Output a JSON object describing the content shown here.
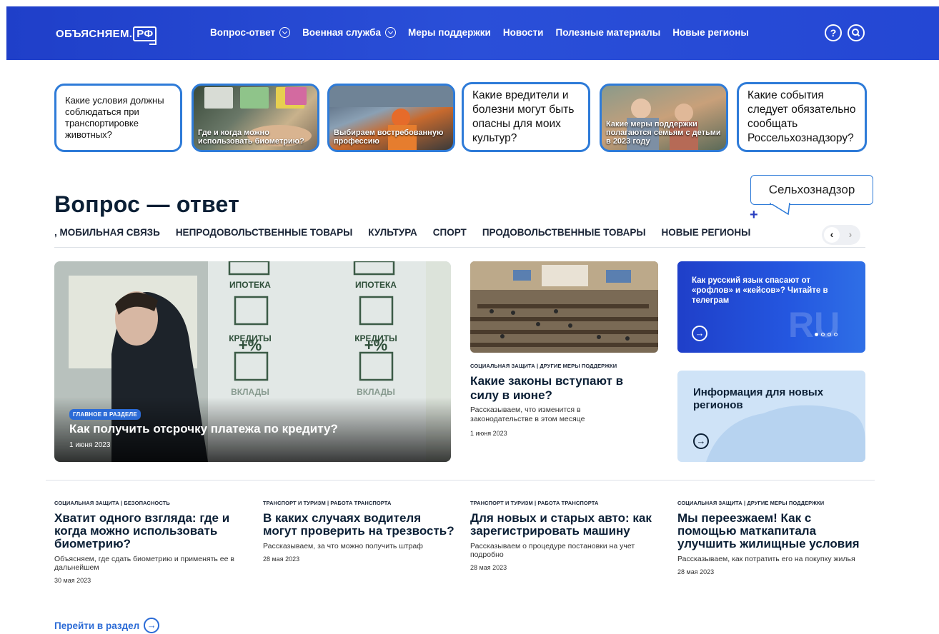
{
  "header": {
    "logo_text": "ОБЪЯСНЯЕМ.",
    "logo_box": "РФ",
    "nav": [
      {
        "label": "Вопрос-ответ",
        "dropdown": true
      },
      {
        "label": "Военная служба",
        "dropdown": true
      },
      {
        "label": "Меры поддержки",
        "dropdown": false
      },
      {
        "label": "Новости",
        "dropdown": false
      },
      {
        "label": "Полезные материалы",
        "dropdown": false
      },
      {
        "label": "Новые регионы",
        "dropdown": false
      }
    ],
    "help_icon": "?",
    "search_icon": "search-icon"
  },
  "stories": [
    {
      "text": "Какие условия должны соблюдаться при транспортировке животных?",
      "type": "text"
    },
    {
      "text": "Где и когда можно использовать биометрию?",
      "type": "image"
    },
    {
      "text": "Выбираем востребованную профессию",
      "type": "image"
    },
    {
      "text": "Какие вредители и болезни могут быть опасны для моих культур?",
      "type": "text"
    },
    {
      "text": "Какие меры поддержки полагаются семьям с детьми в 2023 году",
      "type": "image"
    },
    {
      "text": "Какие события следует обязательно сообщать Россельхознадзору?",
      "type": "text"
    }
  ],
  "section": {
    "title": "Вопрос — ответ",
    "tooltip": "Сельхознадзор",
    "plus": "+",
    "categories": [
      ", МОБИЛЬНАЯ СВЯЗЬ",
      "НЕПРОДОВОЛЬСТВЕННЫЕ ТОВАРЫ",
      "КУЛЬТУРА",
      "СПОРТ",
      "ПРОДОВОЛЬСТВЕННЫЕ ТОВАРЫ",
      "НОВЫЕ РЕГИОНЫ"
    ],
    "prev": "‹",
    "next": "›"
  },
  "main_card": {
    "badge": "ГЛАВНОЕ В РАЗДЕЛЕ",
    "title": "Как получить отсрочку платежа по кредиту?",
    "date": "1 июня 2023",
    "signs": [
      "ИПОТЕКА",
      "КРЕДИТЫ",
      "+%",
      "ВКЛАДЫ",
      "ИПОТЕКА",
      "КРЕДИТЫ",
      "+%",
      "ВКЛАДЫ"
    ]
  },
  "mid_card": {
    "tag": "СОЦИАЛЬНАЯ ЗАЩИТА | ДРУГИЕ МЕРЫ ПОДДЕРЖКИ",
    "title": "Какие законы вступают в силу в июне?",
    "desc": "Рассказываем, что изменится в законодательстве в этом месяце",
    "date": "1 июня 2023"
  },
  "promo1": {
    "text": "Как русский язык спасают от «рофлов» и «кейсов»? Читайте в телеграм",
    "watermark": "RU"
  },
  "promo2": {
    "text": "Информация для новых регионов"
  },
  "articles": [
    {
      "tag": "СОЦИАЛЬНАЯ ЗАЩИТА | БЕЗОПАСНОСТЬ",
      "title": "Хватит одного взгляда: где и когда можно использовать биометрию?",
      "desc": "Объясняем, где сдать биометрию и применять ее в дальнейшем",
      "date": "30 мая 2023"
    },
    {
      "tag": "ТРАНСПОРТ И ТУРИЗМ | РАБОТА ТРАНСПОРТА",
      "title": "В каких случаях водителя могут проверить на трезвость?",
      "desc": "Рассказываем, за что можно получить штраф",
      "date": "28 мая 2023"
    },
    {
      "tag": "ТРАНСПОРТ И ТУРИЗМ | РАБОТА ТРАНСПОРТА",
      "title": "Для новых и старых авто: как зарегистрировать машину",
      "desc": "Рассказываем о процедуре постановки на учет подробно",
      "date": "28 мая 2023"
    },
    {
      "tag": "СОЦИАЛЬНАЯ ЗАЩИТА | ДРУГИЕ МЕРЫ ПОДДЕРЖКИ",
      "title": "Мы переезжаем! Как с помощью маткапитала улучшить жилищные условия",
      "desc": "Рассказываем, как потратить его на покупку жилья",
      "date": "28 мая 2023"
    }
  ],
  "footer_link": "Перейти в раздел",
  "colors": {
    "header": "#2447d4",
    "accent": "#2b6bd6",
    "story_border": "#2e7bd8",
    "text": "#0b1f35"
  }
}
